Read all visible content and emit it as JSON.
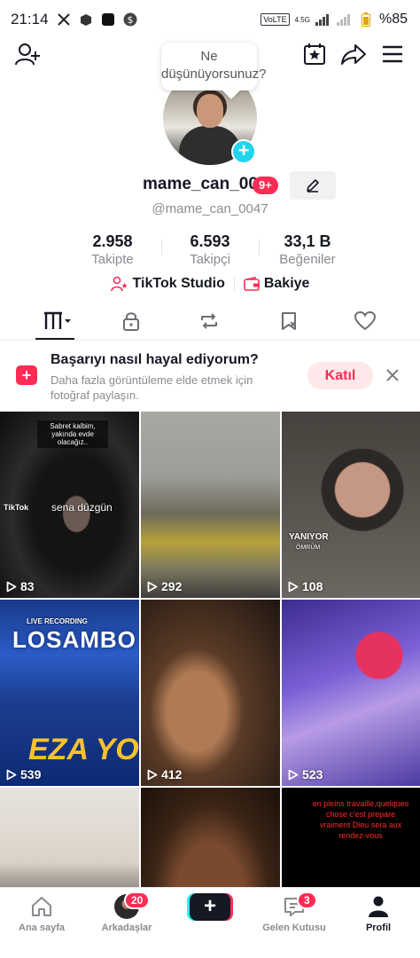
{
  "status_bar": {
    "time": "21:14",
    "battery": "%85",
    "network": "VoLTE",
    "network_gen": "4.5G"
  },
  "top_bar": {
    "add_friend_icon": "person-plus-icon",
    "calendar_icon": "calendar-star-icon",
    "share_icon": "share-arrow-icon",
    "menu_icon": "hamburger-menu-icon"
  },
  "profile": {
    "bubble_text": "Ne düşünüyorsunuz?",
    "username": "mame_can_00",
    "notification_badge": "9+",
    "handle": "@mame_can_0047"
  },
  "stats": [
    {
      "value": "2.958",
      "label": "Takipte"
    },
    {
      "value": "6.593",
      "label": "Takipçi"
    },
    {
      "value": "33,1 B",
      "label": "Beğeniler"
    }
  ],
  "links": {
    "studio": "TikTok Studio",
    "balance": "Bakiye"
  },
  "tabs": [
    {
      "name": "videos",
      "icon": "grid-bars-icon"
    },
    {
      "name": "private",
      "icon": "lock-icon"
    },
    {
      "name": "reposts",
      "icon": "repost-icon"
    },
    {
      "name": "favorites",
      "icon": "bookmark-icon"
    },
    {
      "name": "liked",
      "icon": "heart-icon"
    }
  ],
  "promo": {
    "title": "Başarıyı nasıl hayal ediyorum?",
    "description": "Daha fazla görüntüleme elde etmek için fotoğraf paylaşın.",
    "join_label": "Katıl"
  },
  "videos": [
    {
      "views": "83",
      "caption": "sena düzgün",
      "top_caption": "Sabret kalbim, yakında evde olacağız..",
      "watermark": "TikTok"
    },
    {
      "views": "292"
    },
    {
      "views": "108",
      "caption": "YANIYOR",
      "sub_caption": "ÖMRÜM"
    },
    {
      "views": "539",
      "caption": "LOSAMBO",
      "sub_caption": "EZA YO",
      "top_caption": "LIVE RECORDING"
    },
    {
      "views": "412"
    },
    {
      "views": "523"
    },
    {
      "views": ""
    },
    {
      "views": ""
    },
    {
      "views": "",
      "caption": "en pleins travaille,quelques chose c'est prepare vraiment Dieu sera aux rendez-vous"
    }
  ],
  "bottom_nav": {
    "home": "Ana sayfa",
    "friends": "Arkadaşlar",
    "friends_badge": "20",
    "create": "+",
    "inbox": "Gelen Kutusu",
    "inbox_badge": "3",
    "profile": "Profil"
  }
}
